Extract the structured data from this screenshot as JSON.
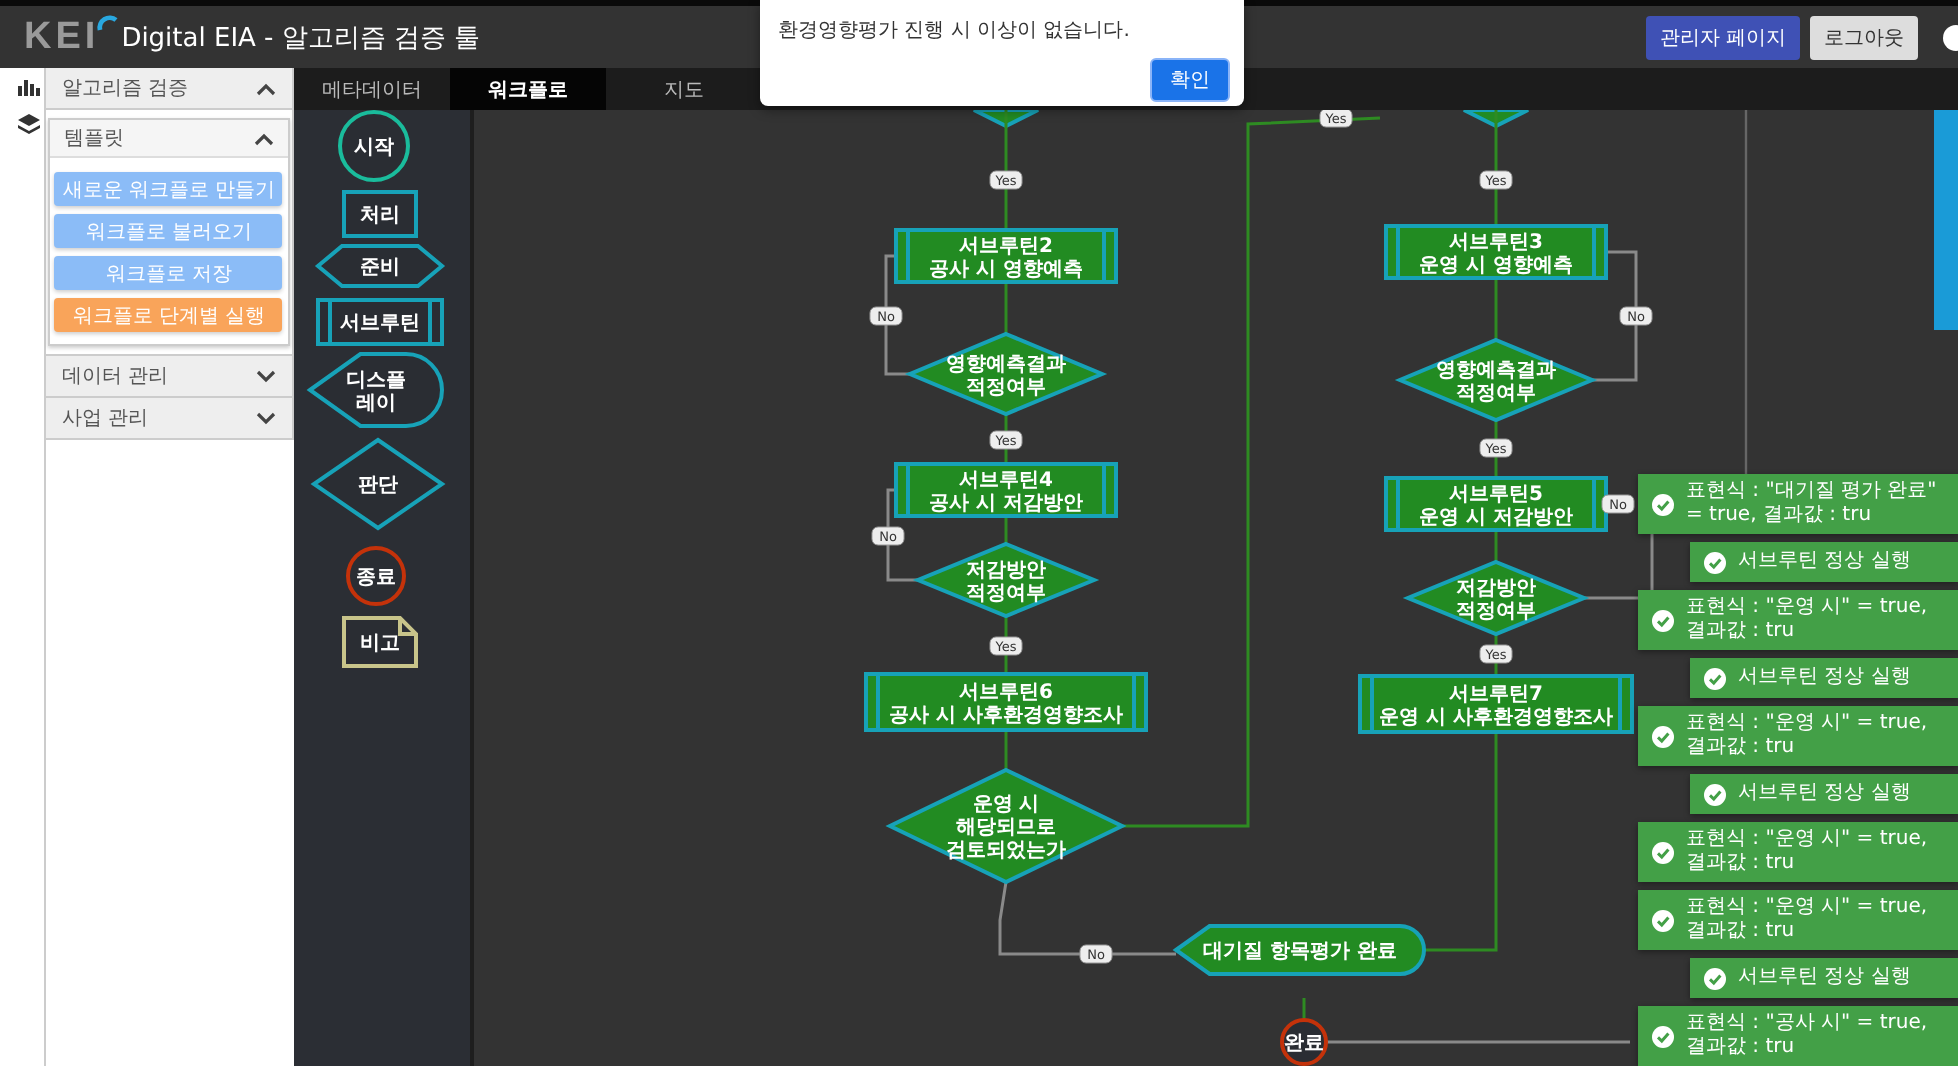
{
  "header": {
    "logo": "KEI",
    "title": "Digital EIA - 알고리즘 검증 툴",
    "buttons": [
      {
        "label": "관리자 페이지",
        "kind": "primary"
      },
      {
        "label": "로그아웃",
        "kind": "secondary"
      }
    ]
  },
  "dialog": {
    "message": "환경영향평가 진행 시 이상이 없습니다.",
    "button": "확인"
  },
  "sidebar": {
    "sections": [
      {
        "label": "알고리즘 검증",
        "expanded": true,
        "groups": [
          {
            "label": "템플릿",
            "expanded": true,
            "actions": [
              {
                "label": "새로운 워크플로 만들기",
                "kind": "normal"
              },
              {
                "label": "워크플로 불러오기",
                "kind": "normal"
              },
              {
                "label": "워크플로 저장",
                "kind": "normal"
              },
              {
                "label": "워크플로 단계별 실행",
                "kind": "highlight"
              }
            ]
          }
        ]
      },
      {
        "label": "데이터 관리",
        "expanded": false
      },
      {
        "label": "사업 관리",
        "expanded": false
      }
    ]
  },
  "tabs": [
    {
      "label": "메타데이터",
      "selected": false
    },
    {
      "label": "워크플로",
      "selected": true
    },
    {
      "label": "지도",
      "selected": false
    }
  ],
  "palette": [
    {
      "kind": "start",
      "label": "시작"
    },
    {
      "kind": "process",
      "label": "처리"
    },
    {
      "kind": "preparation",
      "label": "준비"
    },
    {
      "kind": "subroutine",
      "label": "서브루틴"
    },
    {
      "kind": "display",
      "label": "디스플\n레이"
    },
    {
      "kind": "decision",
      "label": "판단"
    },
    {
      "kind": "end",
      "label": "종료"
    },
    {
      "kind": "note",
      "label": "비고"
    }
  ],
  "diagram": {
    "nodes": [
      {
        "kind": "subroutine",
        "label": "서브루틴2\n공사 시 영향예측"
      },
      {
        "kind": "decision",
        "label": "영향예측결과\n적정여부"
      },
      {
        "kind": "subroutine",
        "label": "서브루틴4\n공사 시 저감방안"
      },
      {
        "kind": "decision",
        "label": "저감방안\n적정여부"
      },
      {
        "kind": "subroutine",
        "label": "서브루틴6\n공사 시 사후환경영향조사"
      },
      {
        "kind": "decision",
        "label": "운영 시\n해당되므로\n검토되었는가"
      },
      {
        "kind": "subroutine",
        "label": "서브루틴3\n운영 시 영향예측"
      },
      {
        "kind": "decision",
        "label": "영향예측결과\n적정여부"
      },
      {
        "kind": "subroutine",
        "label": "서브루틴5\n운영 시 저감방안"
      },
      {
        "kind": "decision",
        "label": "저감방안\n적정여부"
      },
      {
        "kind": "subroutine",
        "label": "서브루틴7\n운영 시 사후환경영향조사"
      },
      {
        "kind": "display",
        "label": "대기질 항목평가 완료"
      },
      {
        "kind": "end",
        "label": "완료"
      }
    ],
    "edge_labels": [
      "Yes",
      "No",
      "Yes",
      "No",
      "Yes",
      "No",
      "Yes",
      "No",
      "Yes",
      "No",
      "Yes",
      "Yes"
    ]
  },
  "log": [
    {
      "kind": "expression",
      "text": "표현식 : \"대기질 평가 완료\" = true, 결과값 : tru"
    },
    {
      "kind": "subroutine",
      "text": "서브루틴 정상 실행"
    },
    {
      "kind": "expression",
      "text": "표현식 : \"운영 시\" = true, 결과값 : tru"
    },
    {
      "kind": "subroutine",
      "text": "서브루틴 정상 실행"
    },
    {
      "kind": "expression",
      "text": "표현식 : \"운영 시\" = true, 결과값 : tru"
    },
    {
      "kind": "subroutine",
      "text": "서브루틴 정상 실행"
    },
    {
      "kind": "expression",
      "text": "표현식 : \"운영 시\" = true, 결과값 : tru"
    },
    {
      "kind": "expression",
      "text": "표현식 : \"운영 시\" = true, 결과값 : tru"
    },
    {
      "kind": "subroutine",
      "text": "서브루틴 정상 실행"
    },
    {
      "kind": "expression",
      "text": "표현식 : \"공사 시\" = true, 결과값 : tru"
    }
  ]
}
